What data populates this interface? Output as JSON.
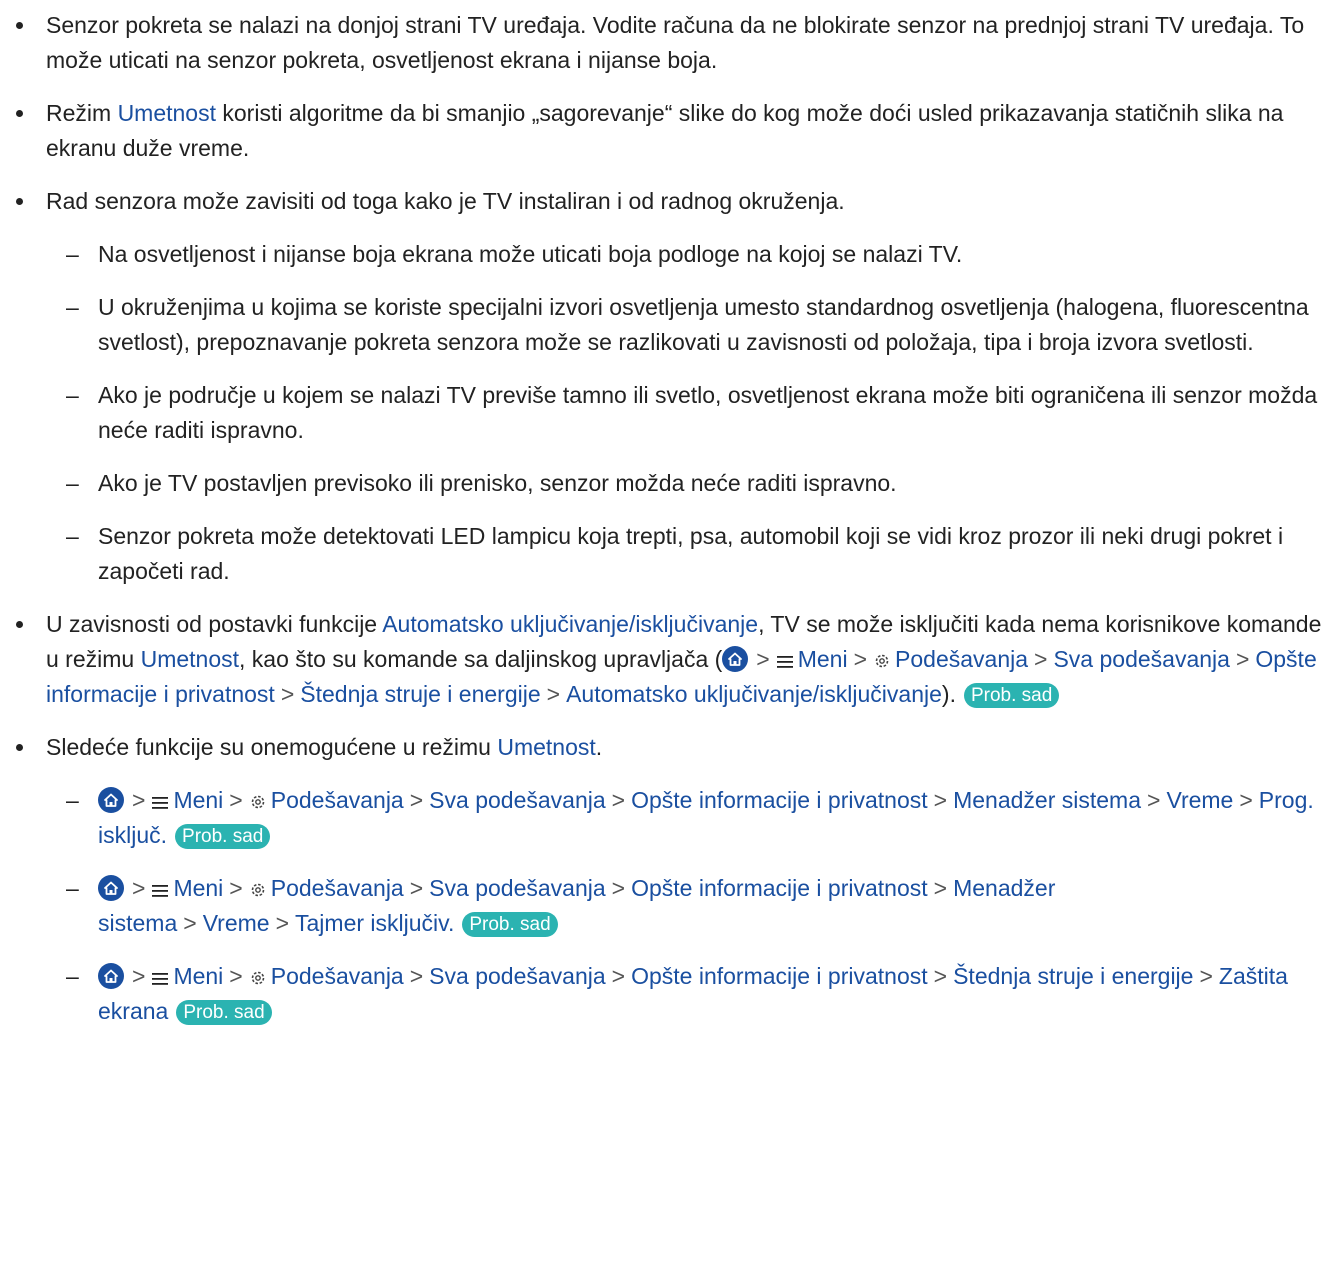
{
  "b1": "Senzor pokreta se nalazi na donjoj strani TV uređaja. Vodite računa da ne blokirate senzor na prednjoj strani TV uređaja. To može uticati na senzor pokreta, osvetljenost ekrana i nijanse boja.",
  "b2": {
    "pre": "Režim ",
    "link": "Umetnost",
    "post": " koristi algoritme da bi smanjio „sagorevanje“ slike do kog može doći usled prikazavanja statičnih slika na ekranu duže vreme."
  },
  "b3": "Rad senzora može zavisiti od toga kako je TV instaliran i od radnog okruženja.",
  "subs": [
    "Na osvetljenost i nijanse boja ekrana može uticati boja podloge na kojoj se nalazi TV.",
    "U okruženjima u kojima se koriste specijalni izvori osvetljenja umesto standardnog osvetljenja (halogena, fluorescentna svetlost), prepoznavanje pokreta senzora može se razlikovati u zavisnosti od položaja, tipa i broja izvora svetlosti.",
    "Ako je područje u kojem se nalazi TV previše tamno ili svetlo, osvetljenost ekrana može biti ograničena ili senzor možda neće raditi ispravno.",
    "Ako je TV postavljen previsoko ili prenisko, senzor možda neće raditi ispravno.",
    "Senzor pokreta može detektovati LED lampicu koja trepti, psa, automobil koji se vidi kroz prozor ili neki drugi pokret i započeti rad."
  ],
  "b4": {
    "t1": "U zavisnosti od postavki funkcije ",
    "link_auto": "Automatsko uključivanje/isključivanje",
    "t2": ", TV se može isključiti kada nema korisnikove komande u režimu ",
    "link_art": "Umetnost",
    "t3": ", kao što su komande sa daljinskog upravljača (",
    "t4": ")."
  },
  "b5": {
    "pre": "Sledeće funkcije su onemogućene u režimu ",
    "link": "Umetnost",
    "post": "."
  },
  "nav": {
    "menu": "Meni",
    "settings": "Podešavanja",
    "all_settings": "Sva podešavanja",
    "general": "Opšte informacije i privatnost",
    "energy": "Štednja struje i energije",
    "auto_onoff": "Automatsko uključivanje/isključivanje",
    "system_manager": "Menadžer sistema",
    "time": "Vreme",
    "prog_off": "Prog. isključ.",
    "timer_off": "Tajmer isključiv.",
    "screen_saver": "Zaštita ekrana",
    "sep": ">"
  },
  "badge": "Prob. sad",
  "colors": {
    "link": "#1a4fa0",
    "badge": "#2bb3b1"
  }
}
